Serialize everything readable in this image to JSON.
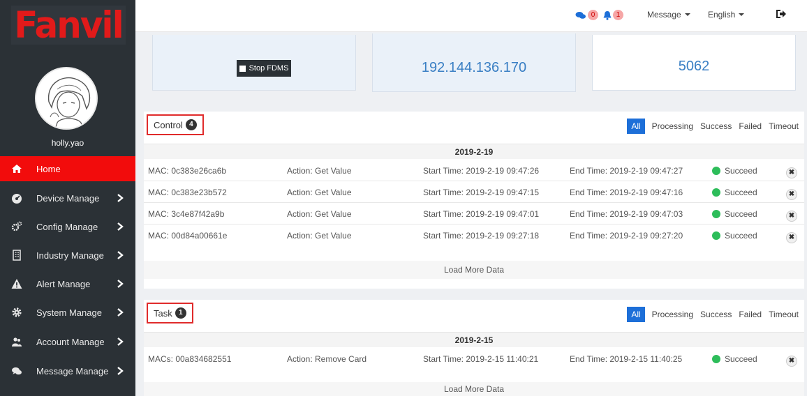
{
  "sidebar": {
    "logo": "Fanvil",
    "username": "holly.yao",
    "items": [
      {
        "label": "Home",
        "icon": "home-icon"
      },
      {
        "label": "Device Manage",
        "icon": "dashboard-icon"
      },
      {
        "label": "Config Manage",
        "icon": "cogs-icon"
      },
      {
        "label": "Industry Manage",
        "icon": "building-icon"
      },
      {
        "label": "Alert Manage",
        "icon": "warning-icon"
      },
      {
        "label": "System Manage",
        "icon": "gear-icon"
      },
      {
        "label": "Account Manage",
        "icon": "users-icon"
      },
      {
        "label": "Message Manage",
        "icon": "comments-icon"
      }
    ]
  },
  "topbar": {
    "comments_count": "0",
    "alerts_count": "1",
    "message_label": "Message",
    "language_label": "English"
  },
  "cards": {
    "stop_label": "Stop FDMS",
    "ip": "192.144.136.170",
    "port": "5062"
  },
  "filters": [
    "All",
    "Processing",
    "Success",
    "Failed",
    "Timeout"
  ],
  "control": {
    "title": "Control",
    "count": "4",
    "date": "2019-2-19",
    "rows": [
      {
        "mac": "MAC: 0c383e26ca6b",
        "action": "Action: Get Value",
        "start": "Start Time: 2019-2-19 09:47:26",
        "end": "End Time: 2019-2-19 09:47:27",
        "status": "Succeed"
      },
      {
        "mac": "MAC: 0c383e23b572",
        "action": "Action: Get Value",
        "start": "Start Time: 2019-2-19 09:47:15",
        "end": "End Time: 2019-2-19 09:47:16",
        "status": "Succeed"
      },
      {
        "mac": "MAC: 3c4e87f42a9b",
        "action": "Action: Get Value",
        "start": "Start Time: 2019-2-19 09:47:01",
        "end": "End Time: 2019-2-19 09:47:03",
        "status": "Succeed"
      },
      {
        "mac": "MAC: 00d84a00661e",
        "action": "Action: Get Value",
        "start": "Start Time: 2019-2-19 09:27:18",
        "end": "End Time: 2019-2-19 09:27:20",
        "status": "Succeed"
      }
    ],
    "load_more": "Load More Data"
  },
  "task": {
    "title": "Task",
    "count": "1",
    "date": "2019-2-15",
    "rows": [
      {
        "mac": "MACs: 00a834682551",
        "action": "Action: Remove Card",
        "start": "Start Time: 2019-2-15 11:40:21",
        "end": "End Time: 2019-2-15 11:40:25",
        "status": "Succeed"
      }
    ],
    "load_more": "Load More Data"
  },
  "colors": {
    "sidebar_bg": "#2b3136",
    "accent_red": "#f20c0c",
    "brand_blue": "#1d6fd8",
    "success_green": "#2dbd5a"
  }
}
